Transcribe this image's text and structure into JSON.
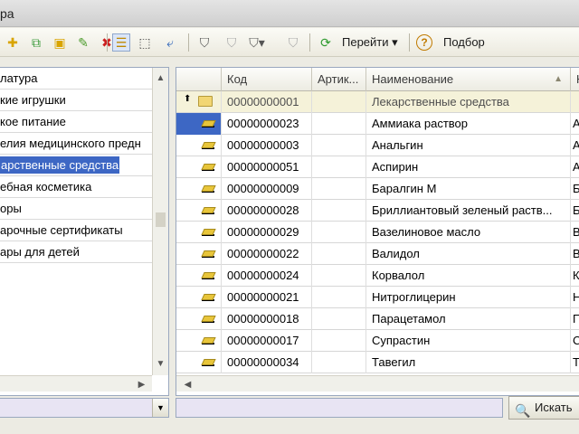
{
  "window": {
    "title": "ра"
  },
  "toolbar": {
    "goto_label": "Перейти",
    "goto_arrow": "▾",
    "selection_label": "Подбор",
    "icons": [
      "add-icon",
      "copy-icon",
      "add-group-icon",
      "edit-icon",
      "delete-icon",
      "hierarchy-icon",
      "select-icon",
      "move-icon",
      "filter-icon",
      "filter-clear-icon",
      "filter-settings-icon",
      "filter-off-icon",
      "refresh-icon",
      "help-icon"
    ]
  },
  "tree": {
    "items": [
      {
        "label": "латура",
        "selected": false
      },
      {
        "label": "кие игрушки",
        "selected": false
      },
      {
        "label": "кое питание",
        "selected": false
      },
      {
        "label": "елия медицинского предн",
        "selected": false
      },
      {
        "label": "арственные средства",
        "selected": true
      },
      {
        "label": "ебная косметика",
        "selected": false
      },
      {
        "label": "оры",
        "selected": false
      },
      {
        "label": "арочные сертификаты",
        "selected": false
      },
      {
        "label": "ары для детей",
        "selected": false
      }
    ]
  },
  "grid": {
    "columns": [
      "Код",
      "Артик...",
      "Наименование",
      "Н"
    ],
    "sort_indicator": "▲",
    "group_row": {
      "code": "00000000001",
      "article": "",
      "name": "Лекарственные средства",
      "extra": ""
    },
    "rows": [
      {
        "code": "00000000023",
        "article": "",
        "name": "Аммиака раствор",
        "extra": "А",
        "active": true
      },
      {
        "code": "00000000003",
        "article": "",
        "name": "Анальгин",
        "extra": "А",
        "active": false
      },
      {
        "code": "00000000051",
        "article": "",
        "name": "Аспирин",
        "extra": "А",
        "active": false
      },
      {
        "code": "00000000009",
        "article": "",
        "name": "Баралгин М",
        "extra": "Б",
        "active": false
      },
      {
        "code": "00000000028",
        "article": "",
        "name": "Бриллиантовый зеленый раств...",
        "extra": "Б",
        "active": false
      },
      {
        "code": "00000000029",
        "article": "",
        "name": "Вазелиновое масло",
        "extra": "В",
        "active": false
      },
      {
        "code": "00000000022",
        "article": "",
        "name": "Валидол",
        "extra": "В",
        "active": false
      },
      {
        "code": "00000000024",
        "article": "",
        "name": "Корвалол",
        "extra": "К",
        "active": false
      },
      {
        "code": "00000000021",
        "article": "",
        "name": "Нитроглицерин",
        "extra": "Н",
        "active": false
      },
      {
        "code": "00000000018",
        "article": "",
        "name": "Парацетамол",
        "extra": "П",
        "active": false
      },
      {
        "code": "00000000017",
        "article": "",
        "name": "Супрастин",
        "extra": "С",
        "active": false
      },
      {
        "code": "00000000034",
        "article": "",
        "name": "Тавегил",
        "extra": "Т",
        "active": false
      }
    ]
  },
  "search": {
    "button_label": "Искать",
    "left_value": "",
    "main_value": ""
  },
  "colors": {
    "selection": "#3d67c4",
    "group_row": "#f5f2d9",
    "search_bg": "#e8e4f3"
  }
}
